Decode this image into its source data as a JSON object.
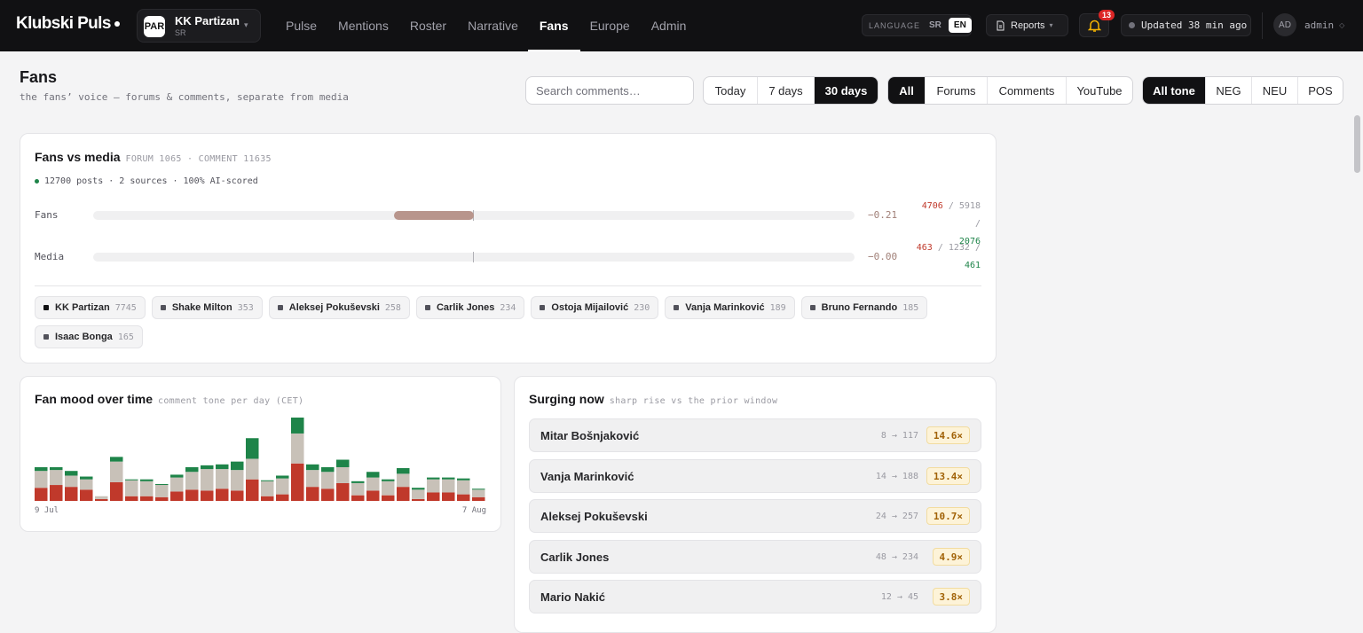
{
  "app": {
    "logo": "Klubski Puls"
  },
  "club": {
    "badge": "PAR",
    "name": "KK Partizan",
    "sub": "SR"
  },
  "nav": [
    {
      "label": "Pulse"
    },
    {
      "label": "Mentions"
    },
    {
      "label": "Roster"
    },
    {
      "label": "Narrative"
    },
    {
      "label": "Fans",
      "active": true
    },
    {
      "label": "Europe"
    },
    {
      "label": "Admin"
    }
  ],
  "language": {
    "label": "LANGUAGE",
    "options": [
      "SR",
      "EN"
    ],
    "selected": "EN"
  },
  "reports": {
    "label": "Reports"
  },
  "notifications": {
    "count": "13"
  },
  "updated": {
    "text": "Updated 38 min ago"
  },
  "user": {
    "initials": "AD",
    "name": "admin"
  },
  "page": {
    "title": "Fans",
    "subtitle": "the fans’ voice — forums & comments, separate from media"
  },
  "search": {
    "placeholder": "Search comments…"
  },
  "filters": {
    "range": {
      "options": [
        "Today",
        "7 days",
        "30 days"
      ],
      "selected": "30 days"
    },
    "source": {
      "options": [
        "All",
        "Forums",
        "Comments",
        "YouTube"
      ],
      "selected": "All"
    },
    "tone": {
      "options": [
        "All tone",
        "NEG",
        "NEU",
        "POS"
      ],
      "selected": "All tone"
    }
  },
  "fans_vs_media": {
    "title": "Fans vs media",
    "meta": "FORUM 1065 · COMMENT 11635",
    "summary": "12700 posts · 2 sources · 100% AI-scored",
    "rows": [
      {
        "label": "Fans",
        "score": "−0.21",
        "score_value": -0.21,
        "neg": "4706",
        "neu": "5918",
        "pos": "2076"
      },
      {
        "label": "Media",
        "score": "−0.00",
        "score_value": 0.0,
        "neg": "463",
        "neu": "1232",
        "pos": "461"
      }
    ],
    "entities": [
      {
        "name": "KK Partizan",
        "count": "7745"
      },
      {
        "name": "Shake Milton",
        "count": "353"
      },
      {
        "name": "Aleksej Pokuševski",
        "count": "258"
      },
      {
        "name": "Carlik Jones",
        "count": "234"
      },
      {
        "name": "Ostoja Mijailović",
        "count": "230"
      },
      {
        "name": "Vanja Marinković",
        "count": "189"
      },
      {
        "name": "Bruno Fernando",
        "count": "185"
      },
      {
        "name": "Isaac Bonga",
        "count": "165"
      }
    ]
  },
  "fan_mood": {
    "title": "Fan mood over time",
    "meta": "comment tone per day (CET)",
    "x_start": "9 Jul",
    "x_end": "7 Aug"
  },
  "chart_data": {
    "type": "bar",
    "stacked": true,
    "x_start": "9 Jul",
    "x_end": "7 Aug",
    "series": [
      {
        "values": [
          14,
          17,
          15,
          12,
          2,
          20,
          5,
          5,
          4,
          10,
          12,
          11,
          13,
          11,
          23,
          5,
          7,
          40,
          15,
          13,
          19,
          6,
          11,
          6,
          15,
          2,
          9,
          9,
          7,
          4
        ]
      },
      {
        "values": [
          18,
          16,
          12,
          11,
          3,
          22,
          17,
          16,
          13,
          15,
          19,
          23,
          21,
          22,
          22,
          16,
          17,
          32,
          18,
          18,
          17,
          13,
          14,
          15,
          14,
          10,
          14,
          14,
          15,
          8
        ]
      },
      {
        "values": [
          4,
          3,
          5,
          3,
          0,
          5,
          1,
          2,
          1,
          3,
          5,
          4,
          5,
          9,
          22,
          1,
          3,
          17,
          6,
          5,
          8,
          2,
          6,
          2,
          6,
          2,
          2,
          2,
          2,
          1
        ]
      }
    ],
    "colors": [
      "#c0392b",
      "#c8c1b8",
      "#1e8449"
    ]
  },
  "surging": {
    "title": "Surging now",
    "meta": "sharp rise vs the prior window",
    "items": [
      {
        "name": "Mitar Bošnjaković",
        "trend": "8 → 117",
        "factor": "14.6×"
      },
      {
        "name": "Vanja Marinković",
        "trend": "14 → 188",
        "factor": "13.4×"
      },
      {
        "name": "Aleksej Pokuševski",
        "trend": "24 → 257",
        "factor": "10.7×"
      },
      {
        "name": "Carlik Jones",
        "trend": "48 → 234",
        "factor": "4.9×"
      },
      {
        "name": "Mario Nakić",
        "trend": "12 → 45",
        "factor": "3.8×"
      }
    ]
  }
}
